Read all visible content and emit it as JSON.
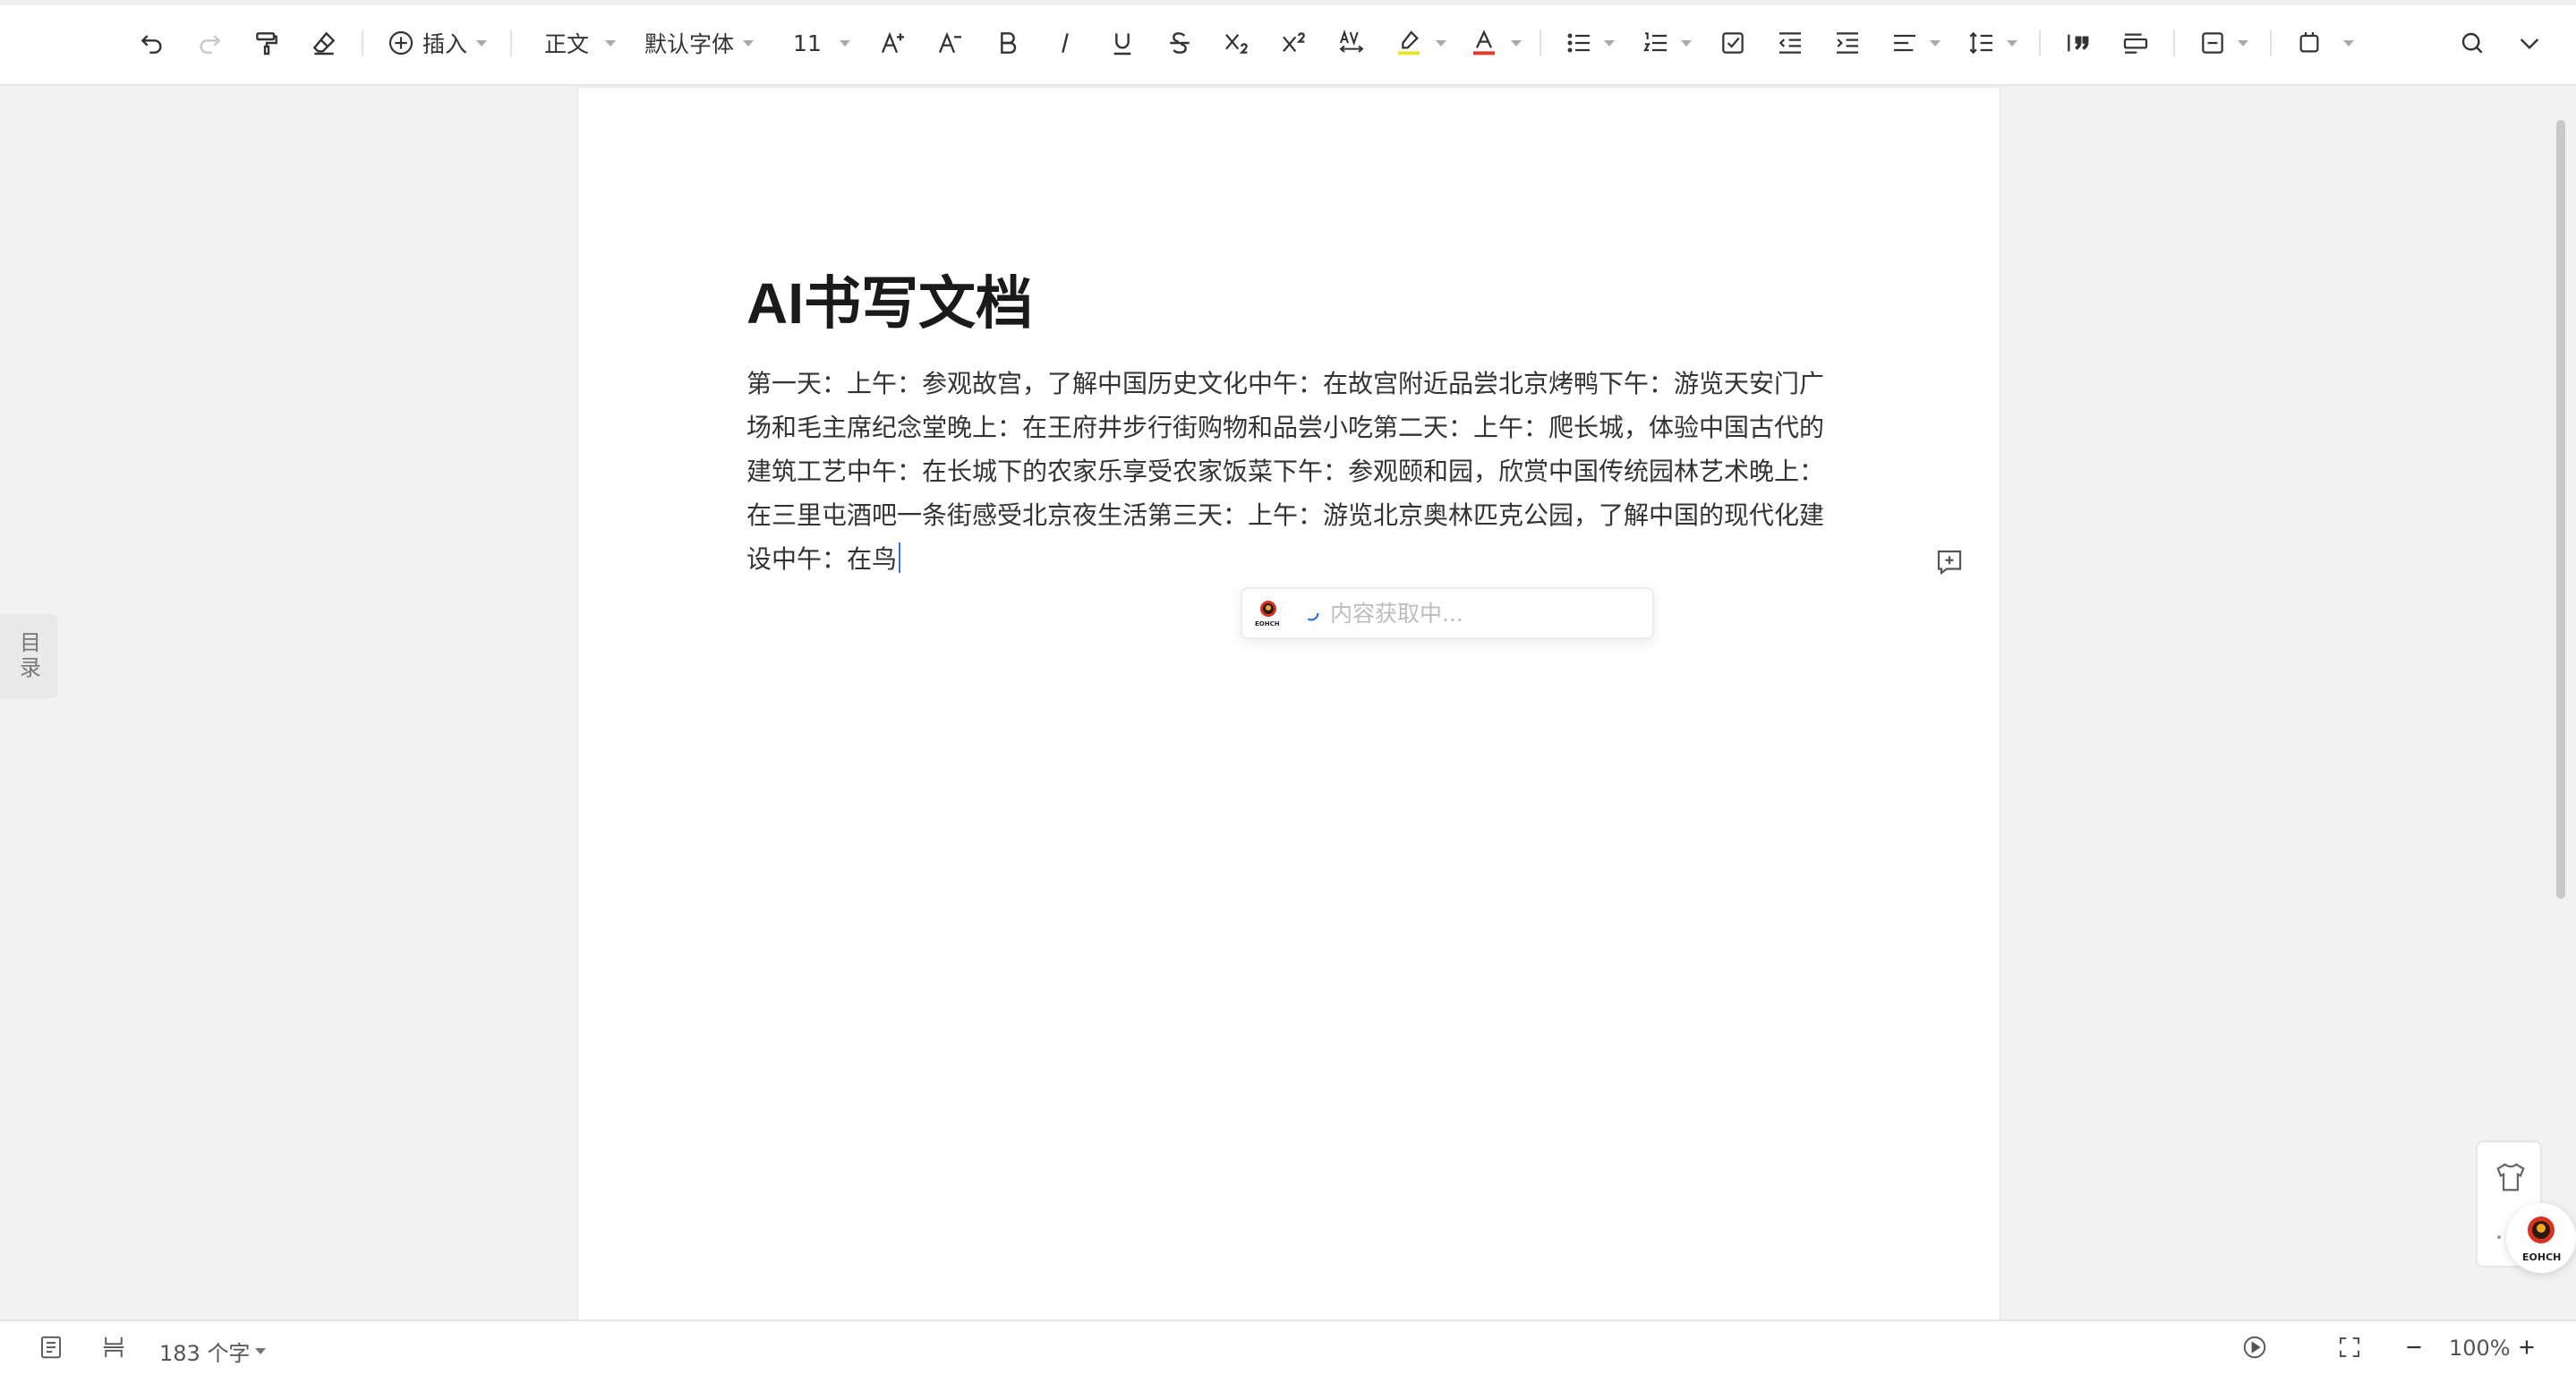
{
  "toolbar": {
    "insert_label": "插入",
    "style_label": "正文",
    "font_label": "默认字体",
    "size_label": "11",
    "colors": {
      "highlight": "#e5e52a",
      "font_color": "#e23b2e"
    }
  },
  "document": {
    "title": "AI书写文档",
    "body": "第一天：上午：参观故宫，了解中国历史文化中午：在故宫附近品尝北京烤鸭下午：游览天安门广场和毛主席纪念堂晚上：在王府井步行街购物和品尝小吃第二天：上午：爬长城，体验中国古代的建筑工艺中午：在长城下的农家乐享受农家饭菜下午：参观颐和园，欣赏中国传统园林艺术晚上：在三里屯酒吧一条街感受北京夜生活第三天：上午：游览北京奥林匹克公园，了解中国的现代化建设中午：在鸟"
  },
  "ai_popup": {
    "placeholder": "内容获取中...",
    "logo_text": "EOHCH"
  },
  "toc": {
    "label": "目录"
  },
  "float_panel": {
    "assistant_text": "EOHCH"
  },
  "statusbar": {
    "word_count": "183 个字",
    "zoom": "100%"
  }
}
